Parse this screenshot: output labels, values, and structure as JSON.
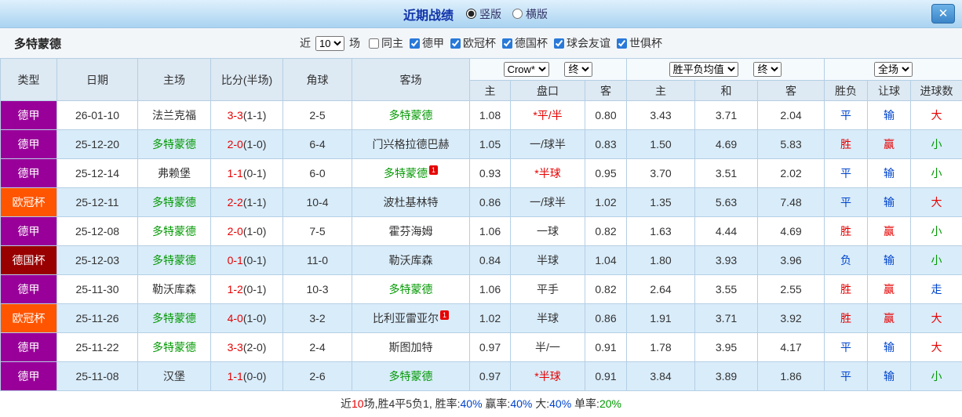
{
  "titlebar": {
    "title": "近期战绩",
    "radio_vertical": "竖版",
    "radio_horizontal": "横版",
    "close": "✕"
  },
  "filter": {
    "team": "多特蒙德",
    "near_label": "近",
    "count_value": "10",
    "games_label": "场",
    "checkboxes": [
      {
        "label": "同主",
        "checked": false
      },
      {
        "label": "德甲",
        "checked": true
      },
      {
        "label": "欧冠杯",
        "checked": true
      },
      {
        "label": "德国杯",
        "checked": true
      },
      {
        "label": "球会友谊",
        "checked": true
      },
      {
        "label": "世俱杯",
        "checked": true
      }
    ]
  },
  "table": {
    "headers": {
      "type": "类型",
      "date": "日期",
      "home": "主场",
      "score": "比分(半场)",
      "corner": "角球",
      "away": "客场",
      "odds1_select": "Crow*",
      "odds1_final": "终",
      "odds2_select": "胜平负均值",
      "odds2_final": "终",
      "result_select": "全场",
      "sub": [
        "主",
        "盘口",
        "客",
        "主",
        "和",
        "客",
        "胜负",
        "让球",
        "进球数"
      ]
    },
    "type_colors": {
      "德甲": "purple",
      "欧冠杯": "orange",
      "德国杯": "darkred"
    },
    "badge_text": "1",
    "rows": [
      {
        "type": "德甲",
        "date": "26-01-10",
        "home": "法兰克福",
        "home_green": false,
        "home_badge": false,
        "score_ft": "3-3",
        "score_ht": "(1-1)",
        "corner": "2-5",
        "away": "多特蒙德",
        "away_green": true,
        "away_badge": false,
        "o1_home": "1.08",
        "handicap": "*平/半",
        "handicap_red": true,
        "o1_away": "0.80",
        "o2_home": "3.43",
        "o2_draw": "3.71",
        "o2_away": "2.04",
        "result": "平",
        "result_c": "blue",
        "give": "输",
        "give_c": "blue",
        "goals": "大",
        "goals_c": "red"
      },
      {
        "type": "德甲",
        "date": "25-12-20",
        "home": "多特蒙德",
        "home_green": true,
        "home_badge": false,
        "score_ft": "2-0",
        "score_ht": "(1-0)",
        "corner": "6-4",
        "away": "门兴格拉德巴赫",
        "away_green": false,
        "away_badge": false,
        "o1_home": "1.05",
        "handicap": "一/球半",
        "handicap_red": false,
        "o1_away": "0.83",
        "o2_home": "1.50",
        "o2_draw": "4.69",
        "o2_away": "5.83",
        "result": "胜",
        "result_c": "red",
        "give": "赢",
        "give_c": "red",
        "goals": "小",
        "goals_c": "green"
      },
      {
        "type": "德甲",
        "date": "25-12-14",
        "home": "弗赖堡",
        "home_green": false,
        "home_badge": false,
        "score_ft": "1-1",
        "score_ht": "(0-1)",
        "corner": "6-0",
        "away": "多特蒙德",
        "away_green": true,
        "away_badge": true,
        "o1_home": "0.93",
        "handicap": "*半球",
        "handicap_red": true,
        "o1_away": "0.95",
        "o2_home": "3.70",
        "o2_draw": "3.51",
        "o2_away": "2.02",
        "result": "平",
        "result_c": "blue",
        "give": "输",
        "give_c": "blue",
        "goals": "小",
        "goals_c": "green"
      },
      {
        "type": "欧冠杯",
        "date": "25-12-11",
        "home": "多特蒙德",
        "home_green": true,
        "home_badge": false,
        "score_ft": "2-2",
        "score_ht": "(1-1)",
        "corner": "10-4",
        "away": "波杜基林特",
        "away_green": false,
        "away_badge": false,
        "o1_home": "0.86",
        "handicap": "一/球半",
        "handicap_red": false,
        "o1_away": "1.02",
        "o2_home": "1.35",
        "o2_draw": "5.63",
        "o2_away": "7.48",
        "result": "平",
        "result_c": "blue",
        "give": "输",
        "give_c": "blue",
        "goals": "大",
        "goals_c": "red"
      },
      {
        "type": "德甲",
        "date": "25-12-08",
        "home": "多特蒙德",
        "home_green": true,
        "home_badge": false,
        "score_ft": "2-0",
        "score_ht": "(1-0)",
        "corner": "7-5",
        "away": "霍芬海姆",
        "away_green": false,
        "away_badge": false,
        "o1_home": "1.06",
        "handicap": "一球",
        "handicap_red": false,
        "o1_away": "0.82",
        "o2_home": "1.63",
        "o2_draw": "4.44",
        "o2_away": "4.69",
        "result": "胜",
        "result_c": "red",
        "give": "赢",
        "give_c": "red",
        "goals": "小",
        "goals_c": "green"
      },
      {
        "type": "德国杯",
        "date": "25-12-03",
        "home": "多特蒙德",
        "home_green": true,
        "home_badge": false,
        "score_ft": "0-1",
        "score_ht": "(0-1)",
        "corner": "11-0",
        "away": "勒沃库森",
        "away_green": false,
        "away_badge": false,
        "o1_home": "0.84",
        "handicap": "半球",
        "handicap_red": false,
        "o1_away": "1.04",
        "o2_home": "1.80",
        "o2_draw": "3.93",
        "o2_away": "3.96",
        "result": "负",
        "result_c": "blue",
        "give": "输",
        "give_c": "blue",
        "goals": "小",
        "goals_c": "green"
      },
      {
        "type": "德甲",
        "date": "25-11-30",
        "home": "勒沃库森",
        "home_green": false,
        "home_badge": false,
        "score_ft": "1-2",
        "score_ht": "(0-1)",
        "corner": "10-3",
        "away": "多特蒙德",
        "away_green": true,
        "away_badge": false,
        "o1_home": "1.06",
        "handicap": "平手",
        "handicap_red": false,
        "o1_away": "0.82",
        "o2_home": "2.64",
        "o2_draw": "3.55",
        "o2_away": "2.55",
        "result": "胜",
        "result_c": "red",
        "give": "赢",
        "give_c": "red",
        "goals": "走",
        "goals_c": "blue"
      },
      {
        "type": "欧冠杯",
        "date": "25-11-26",
        "home": "多特蒙德",
        "home_green": true,
        "home_badge": false,
        "score_ft": "4-0",
        "score_ht": "(1-0)",
        "corner": "3-2",
        "away": "比利亚雷亚尔",
        "away_green": false,
        "away_badge": true,
        "o1_home": "1.02",
        "handicap": "半球",
        "handicap_red": false,
        "o1_away": "0.86",
        "o2_home": "1.91",
        "o2_draw": "3.71",
        "o2_away": "3.92",
        "result": "胜",
        "result_c": "red",
        "give": "赢",
        "give_c": "red",
        "goals": "大",
        "goals_c": "red"
      },
      {
        "type": "德甲",
        "date": "25-11-22",
        "home": "多特蒙德",
        "home_green": true,
        "home_badge": false,
        "score_ft": "3-3",
        "score_ht": "(2-0)",
        "corner": "2-4",
        "away": "斯图加特",
        "away_green": false,
        "away_badge": false,
        "o1_home": "0.97",
        "handicap": "半/一",
        "handicap_red": false,
        "o1_away": "0.91",
        "o2_home": "1.78",
        "o2_draw": "3.95",
        "o2_away": "4.17",
        "result": "平",
        "result_c": "blue",
        "give": "输",
        "give_c": "blue",
        "goals": "大",
        "goals_c": "red"
      },
      {
        "type": "德甲",
        "date": "25-11-08",
        "home": "汉堡",
        "home_green": false,
        "home_badge": false,
        "score_ft": "1-1",
        "score_ht": "(0-0)",
        "corner": "2-6",
        "away": "多特蒙德",
        "away_green": true,
        "away_badge": false,
        "o1_home": "0.97",
        "handicap": "*半球",
        "handicap_red": true,
        "o1_away": "0.91",
        "o2_home": "3.84",
        "o2_draw": "3.89",
        "o2_away": "1.86",
        "result": "平",
        "result_c": "blue",
        "give": "输",
        "give_c": "blue",
        "goals": "小",
        "goals_c": "green"
      }
    ]
  },
  "footer": {
    "segments": [
      {
        "text": "近",
        "color": "dark"
      },
      {
        "text": "10",
        "color": "red"
      },
      {
        "text": "场,胜4平5负1, 胜率:",
        "color": "dark"
      },
      {
        "text": "40%",
        "color": "blue"
      },
      {
        "text": " 赢率:",
        "color": "dark"
      },
      {
        "text": "40%",
        "color": "blue"
      },
      {
        "text": " 大:",
        "color": "dark"
      },
      {
        "text": "40%",
        "color": "blue"
      },
      {
        "text": " 单率:",
        "color": "dark"
      },
      {
        "text": "20%",
        "color": "green"
      }
    ]
  },
  "colors": {
    "red": "#e60000",
    "blue": "#0044cc",
    "green": "#009900",
    "dark": "#333333",
    "purple": "#990099",
    "orange": "#ff5500",
    "darkred": "#990000"
  }
}
